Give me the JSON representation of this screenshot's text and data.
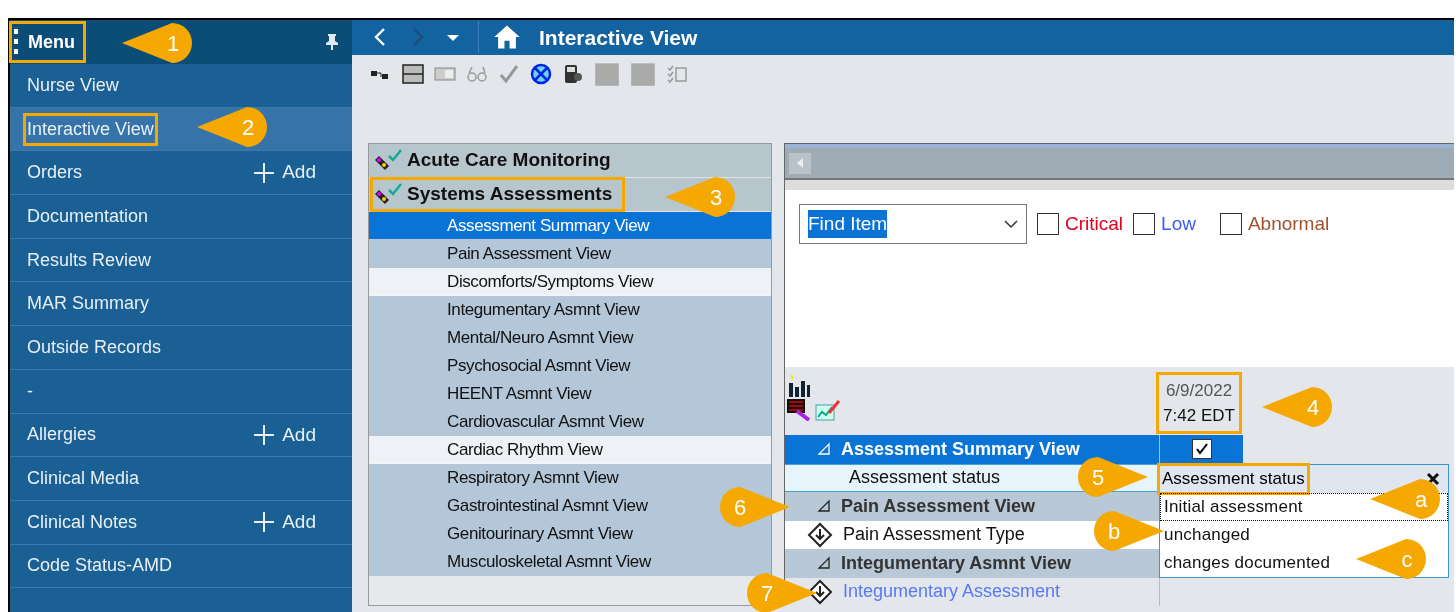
{
  "sidebar": {
    "header": {
      "title": "Menu",
      "highlighted": true
    },
    "items": [
      {
        "label": "Nurse View",
        "selected": false,
        "highlighted": false
      },
      {
        "label": "Interactive View",
        "selected": true,
        "highlighted": true
      },
      {
        "label": "Orders",
        "add": "Add",
        "selected": false,
        "highlighted": false
      },
      {
        "label": "Documentation",
        "selected": false,
        "highlighted": false
      },
      {
        "label": "Results Review",
        "selected": false,
        "highlighted": false
      },
      {
        "label": "MAR Summary",
        "selected": false,
        "highlighted": false
      },
      {
        "label": "Outside Records",
        "selected": false,
        "highlighted": false
      },
      {
        "label": "-",
        "selected": false,
        "highlighted": false
      },
      {
        "label": "Allergies",
        "add": "Add",
        "selected": false,
        "highlighted": false
      },
      {
        "label": "Clinical Media",
        "selected": false,
        "highlighted": false
      },
      {
        "label": "Clinical Notes",
        "add": "Add",
        "selected": false,
        "highlighted": false
      },
      {
        "label": "Code Status-AMD",
        "selected": false,
        "highlighted": false
      }
    ]
  },
  "topbar": {
    "title": "Interactive View"
  },
  "bands": {
    "groups": [
      {
        "title": "Acute Care Monitoring",
        "highlighted": false
      },
      {
        "title": "Systems Assessments",
        "highlighted": true
      }
    ],
    "views": [
      {
        "label": "Assessment Summary View",
        "selected": true,
        "kind": "normal"
      },
      {
        "label": "Pain Assessment View",
        "selected": false,
        "kind": "normal"
      },
      {
        "label": "Discomforts/Symptoms View",
        "selected": false,
        "kind": "light"
      },
      {
        "label": "Integumentary Asmnt View",
        "selected": false,
        "kind": "normal"
      },
      {
        "label": "Mental/Neuro Asmnt View",
        "selected": false,
        "kind": "normal"
      },
      {
        "label": "Psychosocial Asmnt View",
        "selected": false,
        "kind": "normal"
      },
      {
        "label": "HEENT Asmnt View",
        "selected": false,
        "kind": "normal"
      },
      {
        "label": "Cardiovascular Asmnt View",
        "selected": false,
        "kind": "normal"
      },
      {
        "label": "Cardiac Rhythm View",
        "selected": false,
        "kind": "light"
      },
      {
        "label": "Respiratory Asmnt View",
        "selected": false,
        "kind": "normal"
      },
      {
        "label": "Gastrointestinal Asmnt View",
        "selected": false,
        "kind": "normal"
      },
      {
        "label": "Genitourinary Asmnt View",
        "selected": false,
        "kind": "normal"
      },
      {
        "label": "Musculoskeletal Asmnt View",
        "selected": false,
        "kind": "normal"
      }
    ]
  },
  "find": {
    "value": "Find Item"
  },
  "filters": [
    {
      "label": "Critical",
      "checked": false,
      "color": "#e0001b"
    },
    {
      "label": "Low",
      "checked": false,
      "color": "#3b5bff"
    },
    {
      "label": "Abnormal",
      "checked": false,
      "color": "#a0522d"
    }
  ],
  "column": {
    "date": "6/9/2022",
    "time": "7:42 EDT",
    "highlighted": true
  },
  "rows": [
    {
      "kind": "section",
      "label": "Assessment Summary View",
      "selected": true,
      "checked": true
    },
    {
      "kind": "item",
      "label": "Assessment status",
      "selected": false
    },
    {
      "kind": "section",
      "label": "Pain Assessment View",
      "selected": false
    },
    {
      "kind": "item",
      "label": "Pain Assessment Type",
      "selected": false,
      "icon": true
    },
    {
      "kind": "section",
      "label": "Integumentary Asmnt View",
      "selected": false
    },
    {
      "kind": "link",
      "label": "Integumentary Assessment",
      "selected": false,
      "icon": true
    }
  ],
  "dropdown": {
    "title": "Assessment status",
    "highlighted": true,
    "options": [
      {
        "label": "Initial assessment",
        "selected": true
      },
      {
        "label": "unchanged",
        "selected": false
      },
      {
        "label": "changes documented",
        "selected": false
      }
    ]
  },
  "callouts": [
    "1",
    "2",
    "3",
    "4",
    "5",
    "6",
    "7",
    "a",
    "b",
    "c"
  ]
}
